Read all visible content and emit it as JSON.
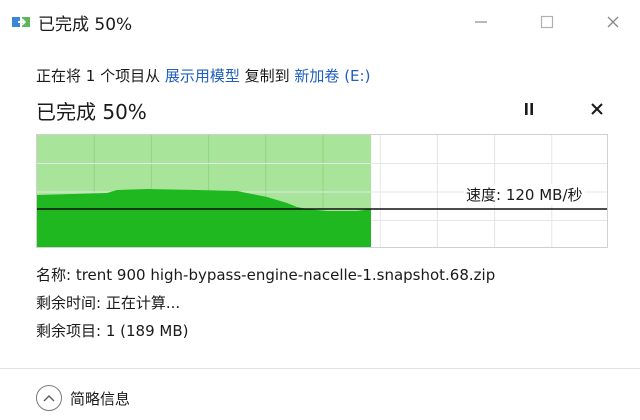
{
  "window": {
    "title": "已完成 50%",
    "minimize_glyph": "—",
    "maximize_glyph": "☐",
    "close_glyph": "✕"
  },
  "operation": {
    "prefix": "正在将 1 个项目从 ",
    "source": "展示用模型",
    "middle": " 复制到 ",
    "destination": "新加卷 (E:)"
  },
  "progress": {
    "label": "已完成 50%",
    "percent": 50
  },
  "controls": {
    "pause_icon": "pause-icon",
    "stop_icon": "close-icon"
  },
  "graph": {
    "speed_text": "速度: 120 MB/秒",
    "fill_color": "#1fb820",
    "completed_bg": "#a8e49a",
    "remaining_bg": "#ffffff"
  },
  "details": {
    "name": "名称: trent 900 high-bypass-engine-nacelle-1.snapshot.68.zip",
    "time_remaining": "剩余时间: 正在计算...",
    "items_remaining": "剩余项目: 1 (189 MB)"
  },
  "footer": {
    "toggle_label": "简略信息"
  },
  "colors": {
    "link": "#1f5fbf",
    "accent": "#1fb820"
  }
}
